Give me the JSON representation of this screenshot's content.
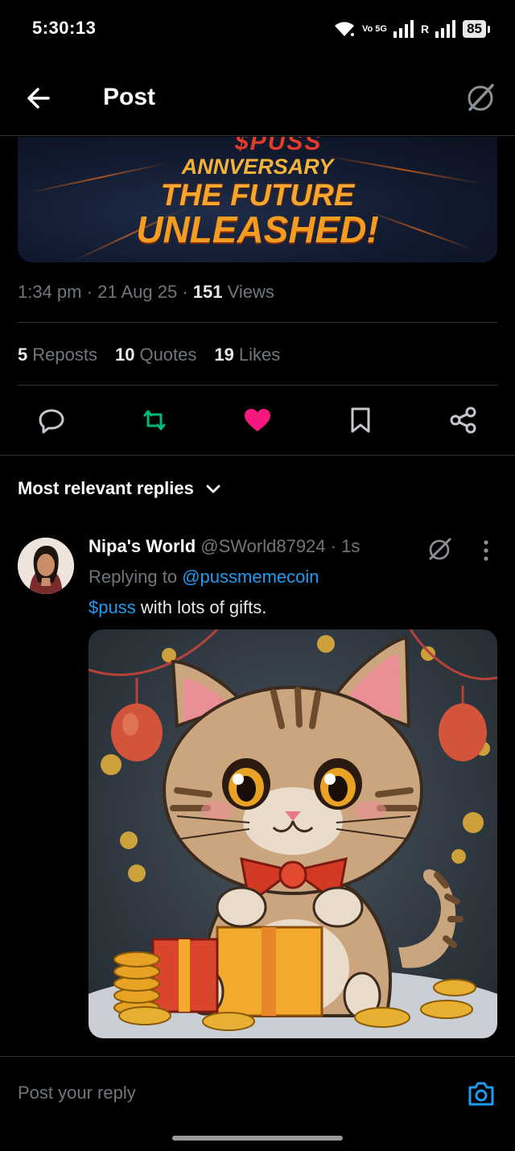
{
  "status_bar": {
    "time": "5:30:13",
    "network_label": "Vo 5G",
    "roaming": "R",
    "battery": "85"
  },
  "header": {
    "title": "Post"
  },
  "banner": {
    "top_text": "$PUSS",
    "line1": "ANNVERSARY",
    "line2": "THE FUTURE",
    "line3": "UNLEASHED!"
  },
  "post_meta": {
    "time": "1:34 pm",
    "date": "21 Aug 25",
    "views_count": "151",
    "views_label": "Views"
  },
  "stats": [
    {
      "count": "5",
      "label": "Reposts"
    },
    {
      "count": "10",
      "label": "Quotes"
    },
    {
      "count": "19",
      "label": "Likes"
    }
  ],
  "actions": {
    "reply_icon": "reply-icon",
    "repost_icon": "repost-icon",
    "like_icon": "heart-icon",
    "bookmark_icon": "bookmark-icon",
    "share_icon": "share-icon",
    "repost_color": "#00ba7c",
    "like_color": "#f91880"
  },
  "replies_sort": {
    "label": "Most relevant replies"
  },
  "reply": {
    "name": "Nipa's World",
    "handle": "@SWorld87924",
    "time": "1s",
    "replying_prefix": "Replying to",
    "replying_to": "@pussmemecoin",
    "text_cashtag": "$puss",
    "text_rest": "with lots of gifts."
  },
  "composer": {
    "placeholder": "Post your reply"
  },
  "colors": {
    "accent": "#1d9bf0",
    "muted": "#71767b",
    "divider": "#2f3336"
  }
}
